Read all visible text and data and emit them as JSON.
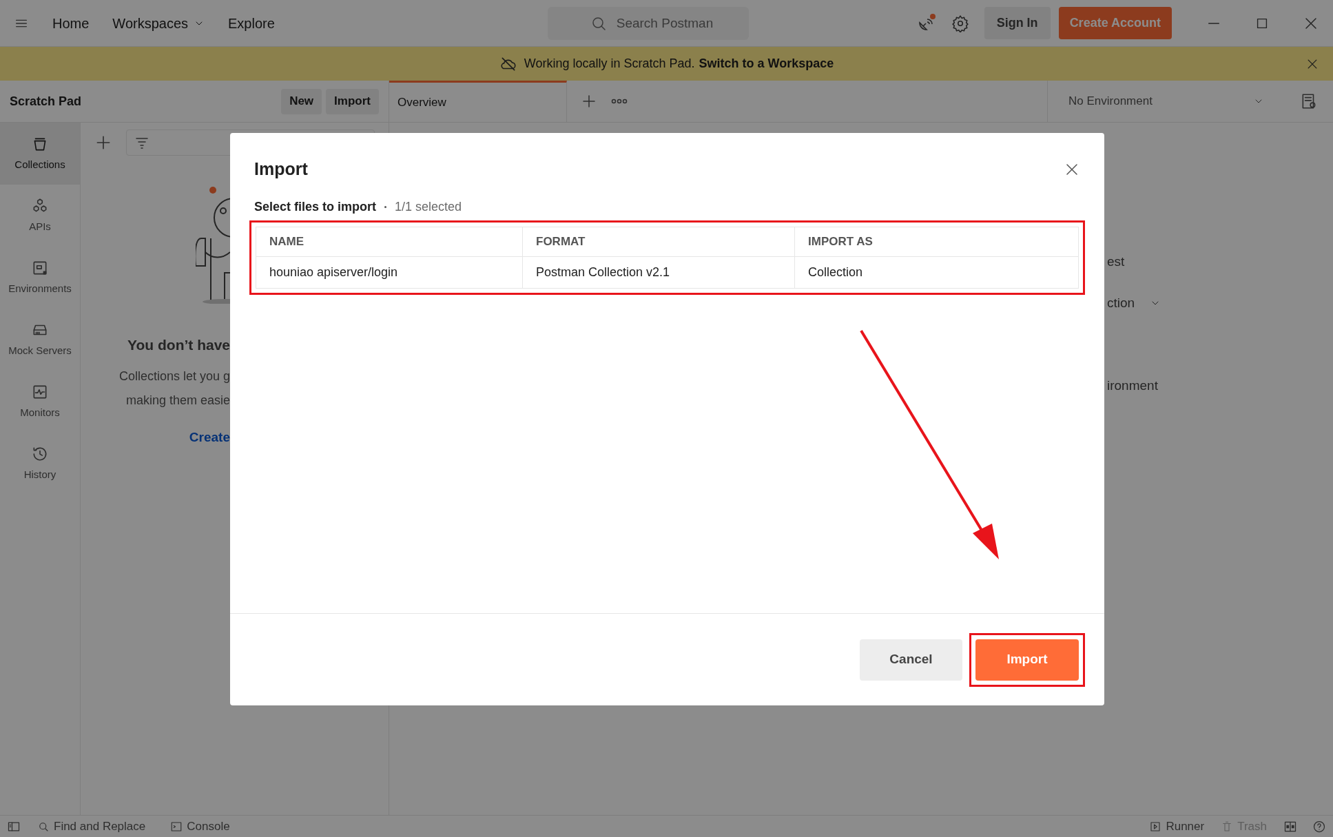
{
  "top_bar": {
    "nav": [
      {
        "label": "Home",
        "dropdown": false
      },
      {
        "label": "Workspaces",
        "dropdown": true
      },
      {
        "label": "Explore",
        "dropdown": false
      }
    ],
    "search": {
      "placeholder": "Search Postman"
    },
    "sign_in": "Sign In",
    "create_account": "Create Account"
  },
  "banner": {
    "text": "Working locally in Scratch Pad.",
    "link": "Switch to a Workspace"
  },
  "scratch_pad": {
    "title": "Scratch Pad",
    "buttons": [
      "New",
      "Import"
    ]
  },
  "tabs": [
    {
      "label": "Overview",
      "selected": true
    }
  ],
  "environment": {
    "value": "No Environment"
  },
  "sidebar": {
    "items": [
      {
        "label": "Collections",
        "kind": "collections",
        "selected": true
      },
      {
        "label": "APIs",
        "kind": "apis",
        "selected": false
      },
      {
        "label": "Environments",
        "kind": "environments",
        "selected": false
      },
      {
        "label": "Mock Servers",
        "kind": "mock",
        "selected": false
      },
      {
        "label": "Monitors",
        "kind": "monitors",
        "selected": false
      },
      {
        "label": "History",
        "kind": "history",
        "selected": false
      }
    ]
  },
  "empty_state": {
    "title": "You don’t have",
    "lines": [
      "Collections let you g",
      "making them easie"
    ],
    "link": "Create"
  },
  "background_fragments": [
    {
      "text": "est",
      "dropdown": false
    },
    {
      "text": "ction",
      "dropdown": true
    },
    {
      "text": "ironment",
      "dropdown": false
    }
  ],
  "dialog": {
    "title": "Import",
    "subtitle": "Select files to import",
    "count": "1/1 selected",
    "table": {
      "columns": [
        "NAME",
        "FORMAT",
        "IMPORT AS"
      ],
      "rows": [
        [
          "houniao apiserver/login",
          "Postman Collection v2.1",
          "Collection"
        ]
      ]
    },
    "buttons": [
      {
        "label": "Cancel",
        "kind": "secondary"
      },
      {
        "label": "Import",
        "kind": "primary"
      }
    ]
  },
  "status_bar": {
    "left": [
      "Find and Replace",
      "Console"
    ],
    "right": [
      {
        "label": "Runner",
        "disabled": false
      },
      {
        "label": "Trash",
        "disabled": true
      }
    ]
  }
}
